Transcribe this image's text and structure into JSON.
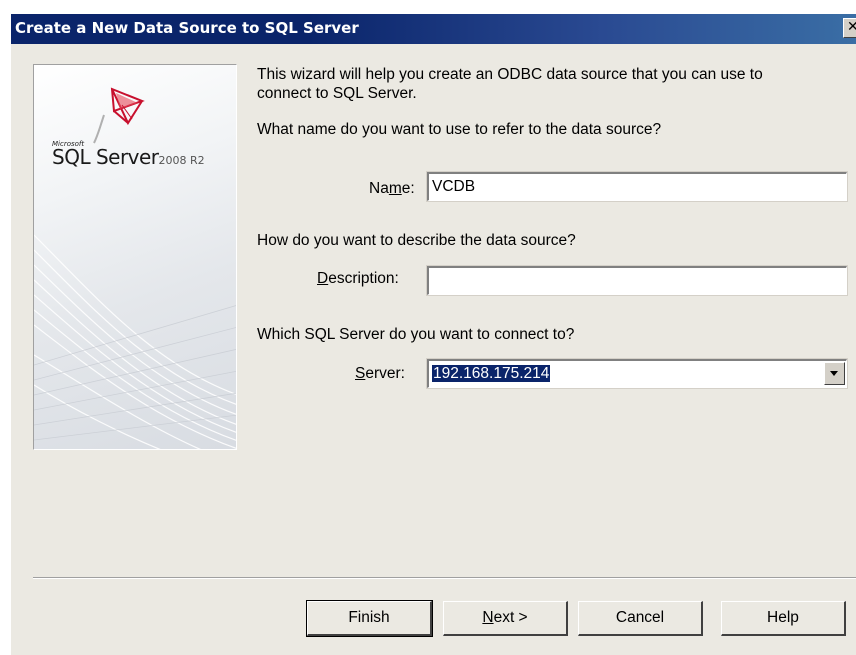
{
  "window": {
    "title": "Create a New Data Source to SQL Server",
    "close_label": "✕"
  },
  "banner": {
    "brand_small": "Microsoft",
    "product": "SQL Server",
    "version": "2008 R2"
  },
  "content": {
    "intro_line1": "This wizard will help you create an ODBC data source that you can use to",
    "intro_line2": "connect to SQL Server.",
    "name_question": "What name do you want to use to refer to the data source?",
    "name_label_pre": "Na",
    "name_label_accel": "m",
    "name_label_post": "e:",
    "name_value": "VCDB",
    "description_question": "How do you want to describe the data source?",
    "description_label_accel": "D",
    "description_label_post": "escription:",
    "description_value": "",
    "server_question": "Which SQL Server do you want to connect to?",
    "server_label_accel": "S",
    "server_label_post": "erver:",
    "server_value": "192.168.175.214"
  },
  "buttons": {
    "finish": "Finish",
    "next_accel": "N",
    "next_post": "ext >",
    "cancel": "Cancel",
    "help": "Help"
  },
  "colors": {
    "titlebar": "#0a246a",
    "selection": "#0a246a",
    "logo_red": "#c8102e"
  }
}
